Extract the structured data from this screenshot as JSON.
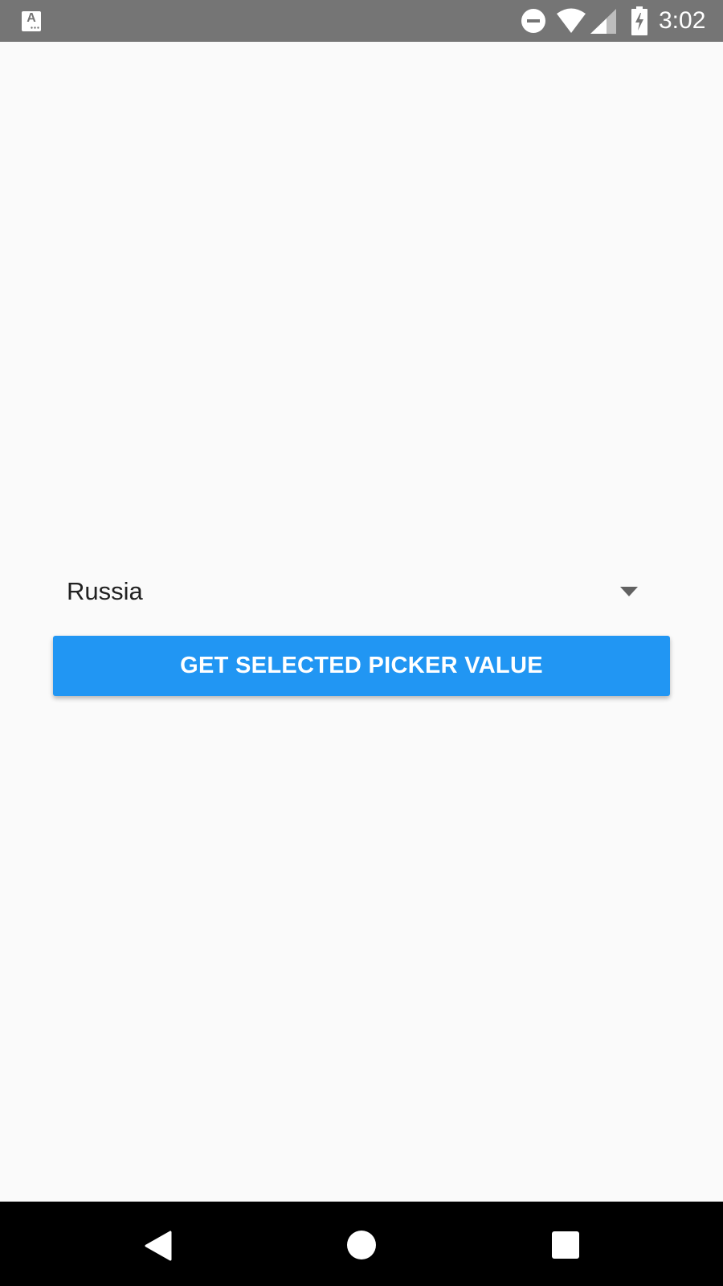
{
  "status_bar": {
    "app_icon": "font-download-icon",
    "app_icon_letter": "A",
    "dnd_icon": "do-not-disturb-icon",
    "wifi_icon": "wifi-icon",
    "signal_icon": "cell-signal-icon",
    "battery_icon": "battery-charging-icon",
    "time": "3:02"
  },
  "picker": {
    "selected_value": "Russia",
    "dropdown_icon": "caret-down-icon"
  },
  "button": {
    "label": "GET SELECTED PICKER VALUE"
  },
  "nav_bar": {
    "back_icon": "back-triangle-icon",
    "home_icon": "home-circle-icon",
    "recents_icon": "recents-square-icon"
  },
  "colors": {
    "status_bar": "#757575",
    "background": "#fafafa",
    "button": "#2196f3",
    "button_text": "#ffffff",
    "nav_bar": "#000000"
  }
}
